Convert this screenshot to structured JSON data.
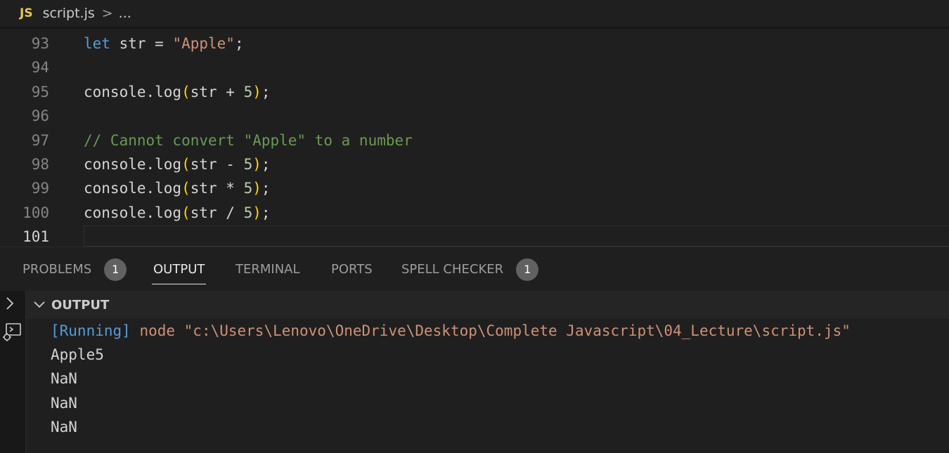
{
  "breadcrumb": {
    "lang_badge": "JS",
    "file": "script.js",
    "separator": ">",
    "more": "..."
  },
  "editor": {
    "lines": [
      {
        "number": "93",
        "tokens": [
          [
            "kw",
            "let"
          ],
          [
            "plain",
            " str = "
          ],
          [
            "str",
            "\"Apple\""
          ],
          [
            "plain",
            ";"
          ]
        ]
      },
      {
        "number": "94",
        "tokens": []
      },
      {
        "number": "95",
        "tokens": [
          [
            "plain",
            "console.log"
          ],
          [
            "paren",
            "("
          ],
          [
            "plain",
            "str + "
          ],
          [
            "num",
            "5"
          ],
          [
            "paren",
            ")"
          ],
          [
            "plain",
            ";"
          ]
        ]
      },
      {
        "number": "96",
        "tokens": []
      },
      {
        "number": "97",
        "tokens": [
          [
            "cm",
            "// Cannot convert \"Apple\" to a number"
          ]
        ]
      },
      {
        "number": "98",
        "tokens": [
          [
            "plain",
            "console.log"
          ],
          [
            "paren",
            "("
          ],
          [
            "plain",
            "str - "
          ],
          [
            "num",
            "5"
          ],
          [
            "paren",
            ")"
          ],
          [
            "plain",
            ";"
          ]
        ]
      },
      {
        "number": "99",
        "tokens": [
          [
            "plain",
            "console.log"
          ],
          [
            "paren",
            "("
          ],
          [
            "plain",
            "str * "
          ],
          [
            "num",
            "5"
          ],
          [
            "paren",
            ")"
          ],
          [
            "plain",
            ";"
          ]
        ]
      },
      {
        "number": "100",
        "tokens": [
          [
            "plain",
            "console.log"
          ],
          [
            "paren",
            "("
          ],
          [
            "plain",
            "str / "
          ],
          [
            "num",
            "5"
          ],
          [
            "paren",
            ")"
          ],
          [
            "plain",
            ";"
          ]
        ]
      },
      {
        "number": "101",
        "tokens": [],
        "active": true
      }
    ]
  },
  "panel": {
    "tabs": [
      {
        "label": "PROBLEMS",
        "badge": "1"
      },
      {
        "label": "OUTPUT",
        "active": true
      },
      {
        "label": "TERMINAL"
      },
      {
        "label": "PORTS"
      },
      {
        "label": "SPELL CHECKER",
        "badge": "1"
      }
    ],
    "section_title": "OUTPUT",
    "output": {
      "running_tag": "[Running]",
      "command": " node \"c:\\Users\\Lenovo\\OneDrive\\Desktop\\Complete Javascript\\04_Lecture\\script.js\"",
      "results": [
        "Apple5",
        "NaN",
        "NaN",
        "NaN"
      ]
    }
  }
}
